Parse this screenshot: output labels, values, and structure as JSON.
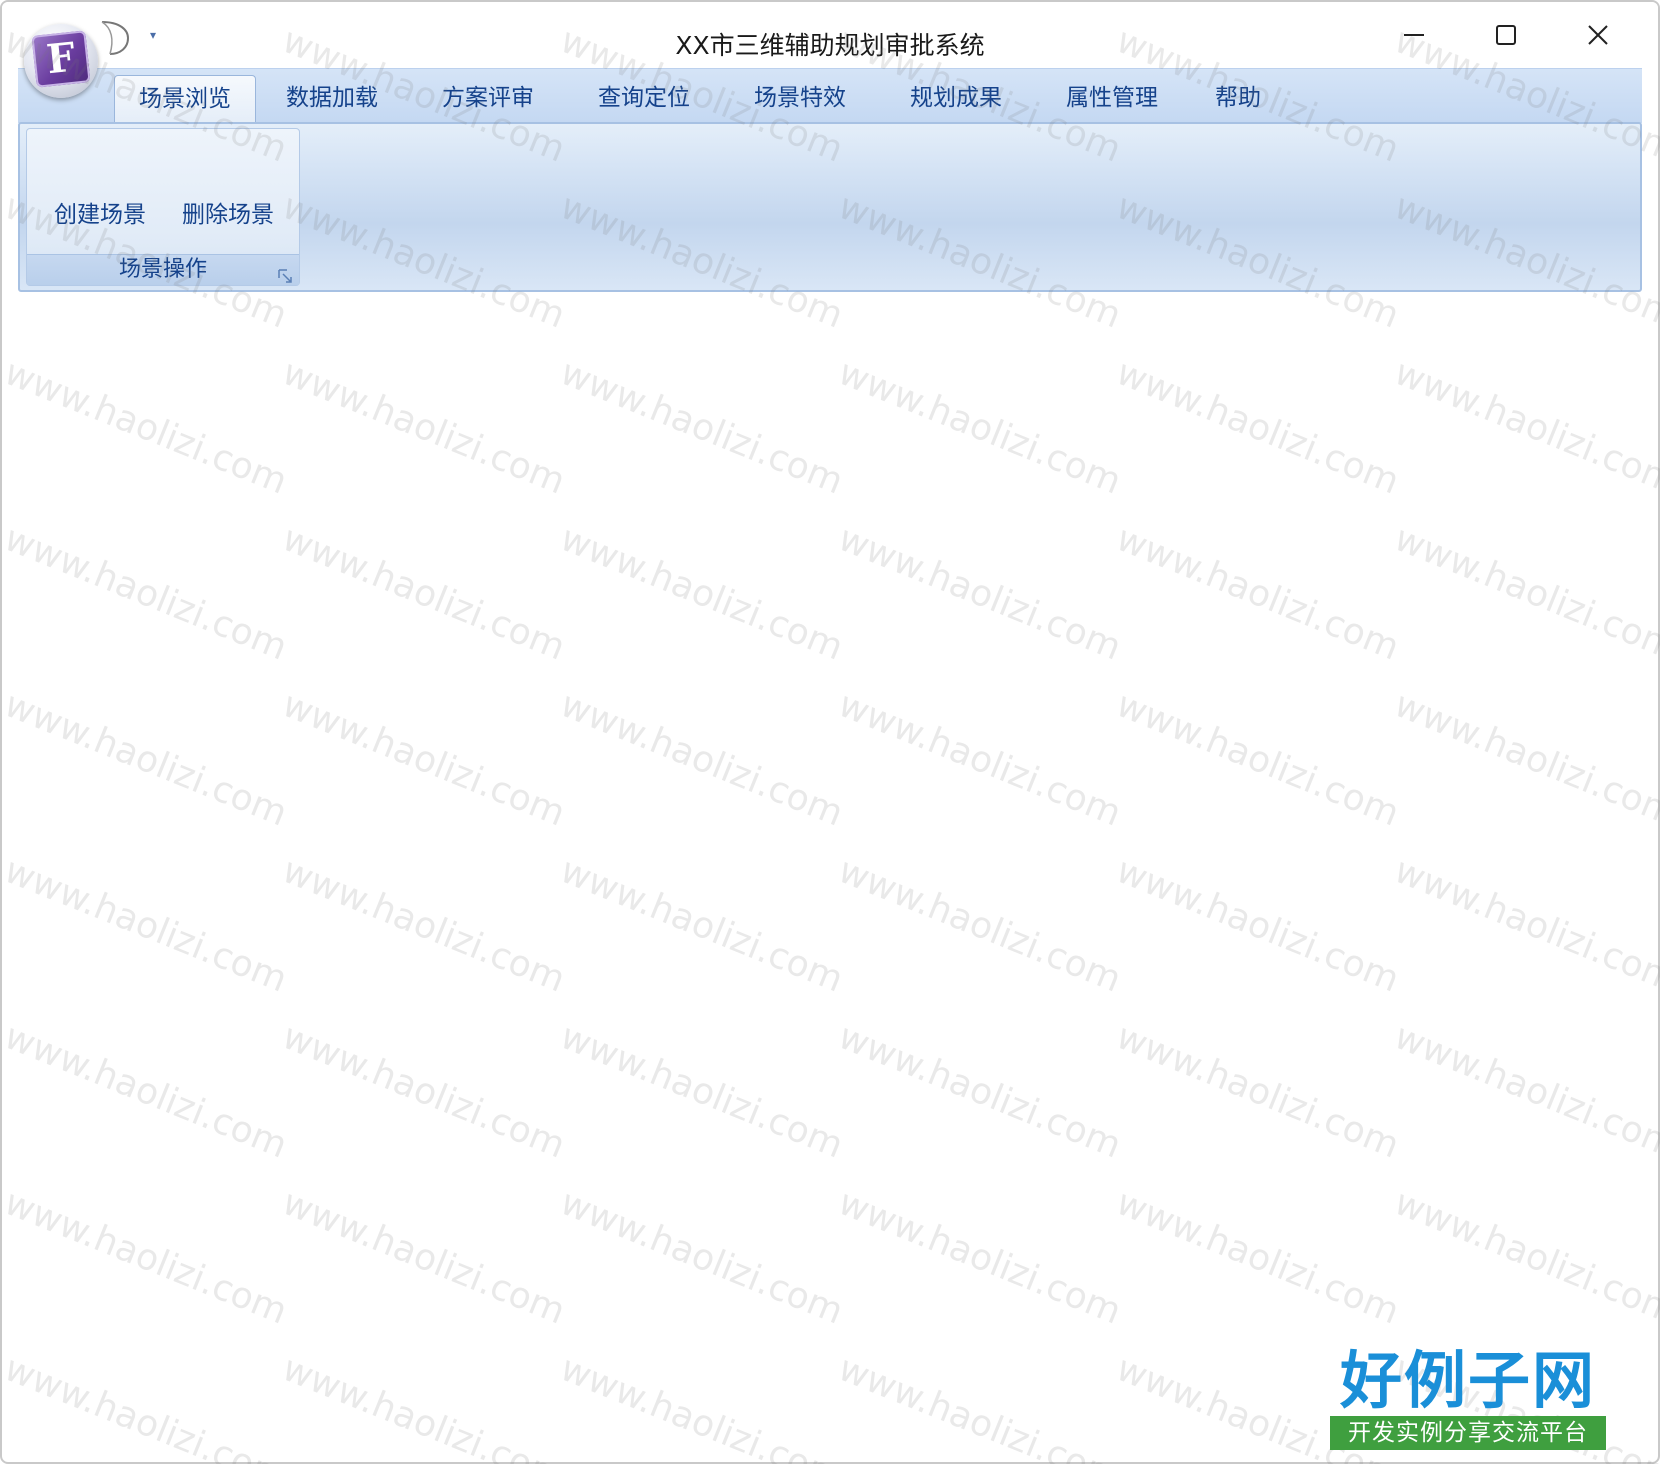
{
  "window": {
    "title": "XX市三维辅助规划审批系统",
    "app_logo_letter": "F"
  },
  "tabs": [
    {
      "label": "场景浏览",
      "active": true
    },
    {
      "label": "数据加载",
      "active": false
    },
    {
      "label": "方案评审",
      "active": false
    },
    {
      "label": "查询定位",
      "active": false
    },
    {
      "label": "场景特效",
      "active": false
    },
    {
      "label": "规划成果",
      "active": false
    },
    {
      "label": "属性管理",
      "active": false
    },
    {
      "label": "帮助",
      "active": false
    }
  ],
  "ribbon": {
    "group": {
      "label": "场景操作",
      "buttons": [
        "创建场景",
        "删除场景"
      ]
    }
  },
  "watermark": {
    "text": "www.haolizi.com",
    "brand_main": "好例子网",
    "brand_sub": "开发实例分享交流平台"
  },
  "colors": {
    "tab_text": "#15428b",
    "ribbon_border": "#a7c1e3",
    "logo_purple": "#6a3d9f",
    "brand_blue": "#1a8fd8",
    "brand_green": "#3f9f3f"
  }
}
